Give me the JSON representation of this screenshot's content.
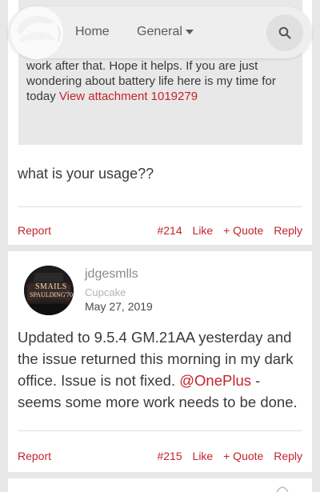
{
  "header": {
    "nav_home": "Home",
    "nav_general": "General"
  },
  "post1": {
    "quote_line_partial": "...",
    "quote_text": "work after that. Hope it helps. If you are just wondering about battery life here is my time for today",
    "quote_link": "View attachment 1019279",
    "message": "what is your usage??",
    "actions": {
      "report": "Report",
      "number": "#214",
      "like": "Like",
      "quote": "+ Quote",
      "reply": "Reply"
    }
  },
  "post2": {
    "user": {
      "name": "jdgesmlls",
      "role": "Cupcake",
      "date": "May 27, 2019",
      "avatar_text_1": "SMAILS",
      "avatar_text_2": "SPAULDING'70"
    },
    "message_part1": "Updated to 9.5.4 GM.21AA yesterday and the issue returned this morning in my dark office. Issue is not fixed. ",
    "mention": "@OnePlus",
    "message_part2": " - seems some more work needs to be done.",
    "actions": {
      "report": "Report",
      "number": "#215",
      "like": "Like",
      "quote": "+ Quote",
      "reply": "Reply"
    }
  },
  "colors": {
    "accent": "#c3242c",
    "background": "#e7e7e7",
    "card": "#ffffff",
    "quote_box": "#e8e8e8"
  },
  "icons": [
    "logo-icon",
    "chevron-down-icon",
    "search-icon"
  ]
}
